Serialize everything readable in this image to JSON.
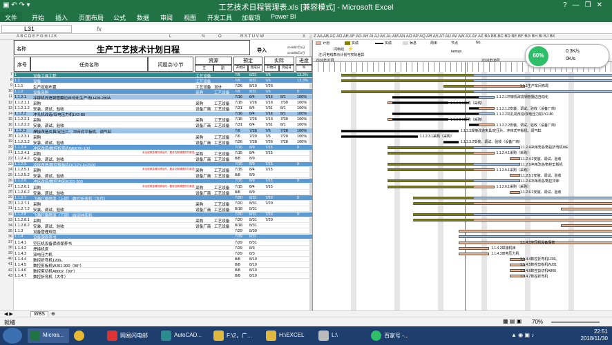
{
  "window": {
    "title": "工艺技术日程管理表.xls [兼容模式] - Microsoft Excel",
    "controls": [
      "?",
      "—",
      "❐",
      "✕"
    ]
  },
  "ribbon_tabs": [
    "文件",
    "开始",
    "插入",
    "页面布局",
    "公式",
    "数据",
    "审阅",
    "视图",
    "开发工具",
    "加载项",
    "Power BI"
  ],
  "formula_bar": {
    "name_box": "L31",
    "fx": "fx",
    "value": ""
  },
  "sheet": {
    "title": "生产工艺技术计划日程",
    "header": {
      "name_label": "名称",
      "seq": "序号",
      "task_name": "任务名称",
      "owner": "问题点/小节",
      "resource": "资源",
      "resource_main": "主",
      "resource_sub": "副",
      "planned": "预定",
      "actual": "实际",
      "progress": "进度",
      "progress_unit": "%",
      "start_date": "开始日",
      "end_date": "完成日",
      "import_label": "导入",
      "import_dates": [
        "2016年7月1日",
        "2016年8月1日"
      ]
    },
    "rows": [
      {
        "n": "7",
        "seq": "1",
        "name": "设备工具工程",
        "r1": "工艺设备",
        "r2": "",
        "ps": "7/6",
        "pe": "8/31",
        "as": "7/6",
        "ae": "",
        "pct": "13.3%",
        "style": "teal"
      },
      {
        "n": "8",
        "seq": "1.1",
        "name": "设备",
        "r1": "工艺设备",
        "r2": "",
        "ps": "7/6",
        "pe": "8/31",
        "as": "7/6",
        "ae": "",
        "pct": "13.3%",
        "style": "blue"
      },
      {
        "n": "9",
        "seq": "1.1.1",
        "name": "生产定组布置",
        "r1": "工艺设备",
        "r2": "设计",
        "ps": "7/26",
        "pe": "8/10",
        "as": "7/26",
        "ae": "",
        "pct": "",
        "style": ""
      },
      {
        "n": "10",
        "seq": "1.1.2",
        "name": "设备采购",
        "r1": "采购",
        "r2": "工艺设备",
        "ps": "7/6",
        "pe": "8/31",
        "as": "7/6",
        "ae": "",
        "pct": "0",
        "style": "blue"
      },
      {
        "n": "11",
        "seq": "1.1.2.1",
        "name": "冲铆机改造钢管翻边自动化生产线LH28-280A",
        "r1": "",
        "r2": "",
        "ps": "7/16",
        "pe": "8/4",
        "as": "7/16",
        "ae": "8/1",
        "pct": "100%",
        "style": "lblue"
      },
      {
        "n": "12",
        "seq": "1.1.2.1.1",
        "name": "采购",
        "r1": "采购",
        "r2": "工艺设备",
        "ps": "7/15",
        "pe": "7/26",
        "as": "7/16",
        "ae": "7/30",
        "pct": "100%",
        "style": ""
      },
      {
        "n": "13",
        "seq": "1.1.2.1.2",
        "name": "安装、调试、验收",
        "r1": "设备厂商",
        "r2": "工艺设备",
        "ps": "7/31",
        "pe": "8/4",
        "as": "7/31",
        "ae": "8/1",
        "pct": "100%",
        "style": ""
      },
      {
        "n": "14",
        "seq": "1.1.2.2",
        "name": "冲孔机改造/双电压力机LY2-80",
        "r1": "",
        "r2": "",
        "ps": "7/16",
        "pe": "8/4",
        "as": "7/16",
        "ae": "8/1",
        "pct": "100%",
        "style": "lblue"
      },
      {
        "n": "15",
        "seq": "1.1.2.2.1",
        "name": "采购",
        "r1": "采购",
        "r2": "工艺设备",
        "ps": "7/15",
        "pe": "7/26",
        "as": "7/16",
        "ae": "7/30",
        "pct": "100%",
        "style": ""
      },
      {
        "n": "16",
        "seq": "1.1.2.2.2",
        "name": "安装、调试、验收",
        "r1": "设备厂商",
        "r2": "工艺设备",
        "ps": "7/31",
        "pe": "8/4",
        "as": "7/31",
        "ae": "8/1",
        "pct": "100%",
        "style": ""
      },
      {
        "n": "17",
        "seq": "1.1.2.3",
        "name": "焊接改造夹具/定压片、冲床式平板机、调气缸",
        "r1": "",
        "r2": "",
        "ps": "7/6",
        "pe": "7/28",
        "as": "7/6",
        "ae": "7/28",
        "pct": "100%",
        "style": "lblue"
      },
      {
        "n": "18",
        "seq": "1.1.2.3.1",
        "name": "采购",
        "r1": "采购",
        "r2": "工艺设备",
        "ps": "7/6",
        "pe": "7/20",
        "as": "7/6",
        "ae": "7/20",
        "pct": "100%",
        "style": ""
      },
      {
        "n": "19",
        "seq": "1.1.2.3.2",
        "name": "安装、调试、验收",
        "r1": "设备厂商",
        "r2": "工艺设备",
        "ps": "7/26",
        "pe": "7/28",
        "as": "7/26",
        "ae": "7/28",
        "pct": "100%",
        "style": ""
      },
      {
        "n": "20",
        "seq": "1.1.2.4",
        "name": "冲床改造/数控折弯机WE67K-100",
        "r1": "",
        "r2": "",
        "ps": "7/15",
        "pe": "8/9",
        "as": "7/15",
        "ae": "",
        "pct": "0",
        "style": "blue"
      },
      {
        "n": "21",
        "seq": "1.1.2.4.1",
        "name": "采购",
        "r1": "采购",
        "r2": "工艺设备",
        "ps": "7/15",
        "pe": "8/4",
        "as": "7/15",
        "ae": "",
        "pct": "",
        "style": "",
        "note": "未出现紧急情况请及时，要求交期请提供付款进度"
      },
      {
        "n": "22",
        "seq": "1.1.2.4.2",
        "name": "安装、调试、验收",
        "r1": "设备厂商",
        "r2": "工艺设备",
        "ps": "8/8",
        "pe": "8/9",
        "as": "",
        "ae": "",
        "pct": "",
        "style": ""
      },
      {
        "n": "23",
        "seq": "1.1.2.5",
        "name": "冲床改造/数控剪板机QC12Y-6×2500",
        "r1": "",
        "r2": "",
        "ps": "7/15",
        "pe": "8/9",
        "as": "7/15",
        "ae": "",
        "pct": "0",
        "style": "blue"
      },
      {
        "n": "24",
        "seq": "1.1.2.5.1",
        "name": "采购",
        "r1": "采购",
        "r2": "工艺设备",
        "ps": "7/15",
        "pe": "8/4",
        "as": "7/15",
        "ae": "",
        "pct": "",
        "style": "",
        "note": "未出现紧急情况请及时，要求交期请提供付款进度"
      },
      {
        "n": "25",
        "seq": "1.1.2.5.2",
        "name": "安装、调试、验收",
        "r1": "设备厂商",
        "r2": "工艺设备",
        "ps": "8/8",
        "pe": "8/9",
        "as": "",
        "ae": "",
        "pct": "",
        "style": ""
      },
      {
        "n": "26",
        "seq": "1.1.2.6",
        "name": "冲床改造/数控冲床WJ01-300",
        "r1": "",
        "r2": "",
        "ps": "7/15",
        "pe": "8/9",
        "as": "7/15",
        "ae": "",
        "pct": "0",
        "style": "blue"
      },
      {
        "n": "27",
        "seq": "1.1.2.6.1",
        "name": "采购",
        "r1": "采购",
        "r2": "工艺设备",
        "ps": "7/15",
        "pe": "8/4",
        "as": "7/15",
        "ae": "",
        "pct": "",
        "style": "",
        "note": "未出现紧急情况请及时，要求交期请提供付款进度"
      },
      {
        "n": "28",
        "seq": "1.1.2.6.2",
        "name": "安装、调试、验收",
        "r1": "设备厂商",
        "r2": "工艺设备",
        "ps": "8/8",
        "pe": "8/9",
        "as": "",
        "ae": "",
        "pct": "",
        "style": ""
      },
      {
        "n": "29",
        "seq": "1.1.2.7",
        "name": "飞溅打磨喷漆（上层）/数控折弯机（大件）",
        "r1": "",
        "r2": "",
        "ps": "7/20",
        "pe": "8/31",
        "as": "7/20",
        "ae": "",
        "pct": "0",
        "style": "blue"
      },
      {
        "n": "30",
        "seq": "1.1.2.7.1",
        "name": "采购",
        "r1": "采购",
        "r2": "工艺设备",
        "ps": "7/20",
        "pe": "8/31",
        "as": "7/20",
        "ae": "",
        "pct": "",
        "style": ""
      },
      {
        "n": "31",
        "seq": "1.1.2.7.2",
        "name": "安装、调试、验收",
        "r1": "设备厂商",
        "r2": "工艺设备",
        "ps": "8/18",
        "pe": "8/31",
        "as": "",
        "ae": "",
        "pct": "",
        "style": ""
      },
      {
        "n": "32",
        "seq": "1.1.2.8",
        "name": "飞溅打磨喷漆（下层）/自动冲床机",
        "r1": "",
        "r2": "",
        "ps": "7/20",
        "pe": "8/31",
        "as": "7/20",
        "ae": "",
        "pct": "0",
        "style": "blue"
      },
      {
        "n": "33",
        "seq": "1.1.2.8.1",
        "name": "采购",
        "r1": "采购",
        "r2": "工艺设备",
        "ps": "7/20",
        "pe": "8/31",
        "as": "7/20",
        "ae": "",
        "pct": "",
        "style": ""
      },
      {
        "n": "34",
        "seq": "1.1.2.8.2",
        "name": "安装、调试、验收",
        "r1": "设备厂商",
        "r2": "工艺设备",
        "ps": "8/18",
        "pe": "8/31",
        "as": "",
        "ae": "",
        "pct": "",
        "style": ""
      },
      {
        "n": "35",
        "seq": "1.1.3",
        "name": "设备管理规范",
        "r1": "",
        "r2": "",
        "ps": "7/29",
        "pe": "8/30",
        "as": "",
        "ae": "",
        "pct": "",
        "style": ""
      },
      {
        "n": "36",
        "seq": "1.1.4",
        "name": "设备保修养书",
        "r1": "",
        "r2": "",
        "ps": "7/29",
        "pe": "8/31",
        "as": "",
        "ae": "",
        "pct": "",
        "style": "blue"
      },
      {
        "n": "37",
        "seq": "1.1.4.1",
        "name": "空压机设备保修保养书",
        "r1": "",
        "r2": "",
        "ps": "7/29",
        "pe": "8/31",
        "as": "",
        "ae": "",
        "pct": "",
        "style": ""
      },
      {
        "n": "38",
        "seq": "1.1.4.2",
        "name": "焊接机床",
        "r1": "",
        "r2": "",
        "ps": "7/29",
        "pe": "8/3",
        "as": "",
        "ae": "",
        "pct": "",
        "style": ""
      },
      {
        "n": "39",
        "seq": "1.1.4.3",
        "name": "双电压力机",
        "r1": "",
        "r2": "",
        "ps": "7/29",
        "pe": "8/3",
        "as": "",
        "ae": "",
        "pct": "",
        "style": ""
      },
      {
        "n": "40",
        "seq": "1.1.4.4",
        "name": "数控折弯机1200。",
        "r1": "",
        "r2": "",
        "ps": "8/8",
        "pe": "8/10",
        "as": "",
        "ae": "",
        "pct": "",
        "style": ""
      },
      {
        "n": "41",
        "seq": "1.1.4.5",
        "name": "数控剪板机WJ01-300（90°）",
        "r1": "",
        "r2": "",
        "ps": "8/8",
        "pe": "8/10",
        "as": "",
        "ae": "",
        "pct": "",
        "style": ""
      },
      {
        "n": "42",
        "seq": "1.1.4.6",
        "name": "数控剪切机A8002（90°）",
        "r1": "",
        "r2": "",
        "ps": "8/8",
        "pe": "8/10",
        "as": "",
        "ae": "",
        "pct": "",
        "style": ""
      },
      {
        "n": "43",
        "seq": "1.1.4.7",
        "name": "数控折弯机（大件）",
        "r1": "",
        "r2": "",
        "ps": "8/8",
        "pe": "8/10",
        "as": "",
        "ae": "",
        "pct": "",
        "style": ""
      }
    ]
  },
  "gantt": {
    "legend": {
      "plan": "计划",
      "actual": "实绩",
      "actual_line": "实绩",
      "holiday": "休息",
      "weekend": "周末",
      "milestone": "节点",
      "flash": "闪电线",
      "flash_desc": "注:闪电线表示计划与实际差异",
      "user_label": "heman",
      "no_label": "No."
    },
    "months": [
      "2016年07月",
      "2016年08月"
    ],
    "labels": [
      {
        "row": 2,
        "text": "1.1.1生产车间布局"
      },
      {
        "row": 4,
        "text": "1.1.2.1冲铆机改造钢管翻边自动化"
      },
      {
        "row": 5,
        "text": "1.1.2.1.1采购（采购）"
      },
      {
        "row": 6,
        "text": "1.1.2.1.2安装、调试、验收（设备厂商）"
      },
      {
        "row": 7,
        "text": "1.1.2.2冲孔机改造/双电压力机LY2-80"
      },
      {
        "row": 8,
        "text": "1.1.2.2.1采购（采购）"
      },
      {
        "row": 9,
        "text": "1.1.2.2.2安装、调试、验收（设备厂商）"
      },
      {
        "row": 10,
        "text": "1.1.2.3焊接改造夹具/定压片、冲床式平板机、调气缸"
      },
      {
        "row": 11,
        "text": "1.1.2.3.1采购（采购）"
      },
      {
        "row": 12,
        "text": "1.1.2.3.2安装、调试、验收（设备厂商）"
      },
      {
        "row": 13,
        "text": "1.1.2.4冲床改造/数控折弯机WE"
      },
      {
        "row": 14,
        "text": "1.1.2.4.1采购（采购）"
      },
      {
        "row": 15,
        "text": "1.1.2.4.2安装、调试、验收"
      },
      {
        "row": 16,
        "text": "1.1.2.5冲床改造/数控剪板机"
      },
      {
        "row": 17,
        "text": "1.1.2.5.1采购（采购）"
      },
      {
        "row": 18,
        "text": "1.1.2.5.2安装、调试、验收"
      },
      {
        "row": 19,
        "text": "1.1.2.6冲床改造/数控冲床"
      },
      {
        "row": 20,
        "text": "1.1.2.6.1采购（采购）"
      },
      {
        "row": 21,
        "text": "1.1.2.6.2安装、调试、验收"
      },
      {
        "row": 30,
        "text": "1.1.4.1空压机设备保修"
      },
      {
        "row": 31,
        "text": "1.1.4.2焊接机床"
      },
      {
        "row": 32,
        "text": "1.1.4.3双电压力机"
      },
      {
        "row": 33,
        "text": "1.1.4.4数控折弯机1200。"
      },
      {
        "row": 34,
        "text": "1.1.4.5数控剪板机WJ01"
      },
      {
        "row": 35,
        "text": "1.1.4.6数控剪切机A800"
      },
      {
        "row": 36,
        "text": "1.1.4.7数控折弯机"
      }
    ]
  },
  "sheet_tab": "WBS",
  "status": {
    "ready": "就绪",
    "zoom": "70%"
  },
  "net_widget": {
    "percent": "60%",
    "up": "0.3K/s",
    "down": "0K/s"
  },
  "taskbar": {
    "items": [
      "Micros...",
      "网易闪电邮",
      "AutoCAD...",
      "F:\\2，广...",
      "H:\\EXCEL",
      "L:\\",
      "百家号 -..."
    ],
    "time": "22:51",
    "date": "2018/11/30"
  },
  "colors": {
    "excel_green": "#217346",
    "plan_bar": "#f4b183",
    "actual_bar": "#7f7f00",
    "done_bar": "#1f7a6b",
    "blue_row": "#5b9bd5"
  }
}
